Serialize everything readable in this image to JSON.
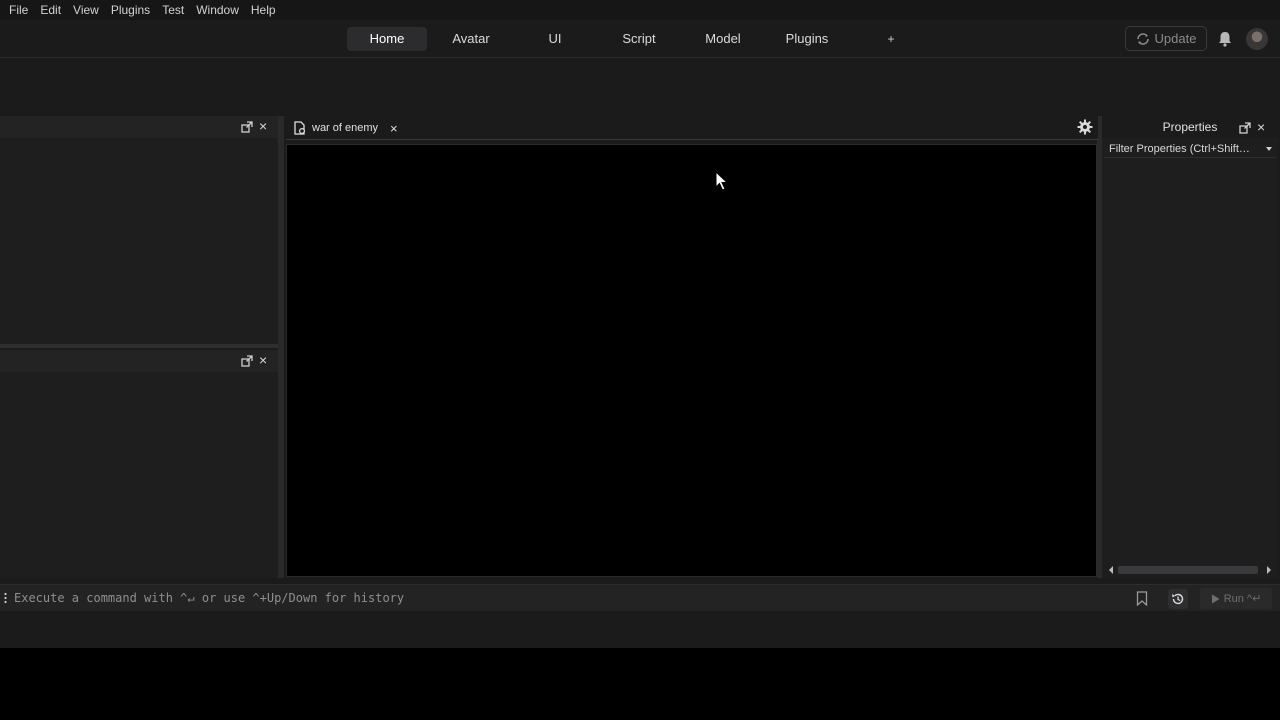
{
  "menubar": {
    "items": [
      "File",
      "Edit",
      "View",
      "Plugins",
      "Test",
      "Window",
      "Help"
    ]
  },
  "ribbon": {
    "tabs": [
      "Home",
      "Avatar",
      "UI",
      "Script",
      "Model",
      "Plugins"
    ],
    "active_tab": "Home",
    "add_tab_label": "+",
    "update_label": "Update"
  },
  "document": {
    "tab_title": "war of enemy",
    "close_glyph": "×"
  },
  "properties": {
    "title": "Properties",
    "filter_placeholder": "Filter Properties (Ctrl+Shift…"
  },
  "command_bar": {
    "placeholder": "Execute a command with ^↵ or use ^+Up/Down for history",
    "run_label": "Run ^↵"
  },
  "icons": {
    "panel_undock": "undock-icon",
    "panel_close": "close-icon",
    "gear": "gear-icon",
    "bell": "bell-icon",
    "bookmark": "bookmark-icon",
    "history": "history-icon",
    "play": "play-icon",
    "script_doc": "script-document-icon"
  },
  "colors": {
    "background": "#1b1b1c",
    "menubar": "#161617",
    "viewport": "#000000",
    "active_tab": "#2c2c2e",
    "text": "#cfcfcf"
  }
}
